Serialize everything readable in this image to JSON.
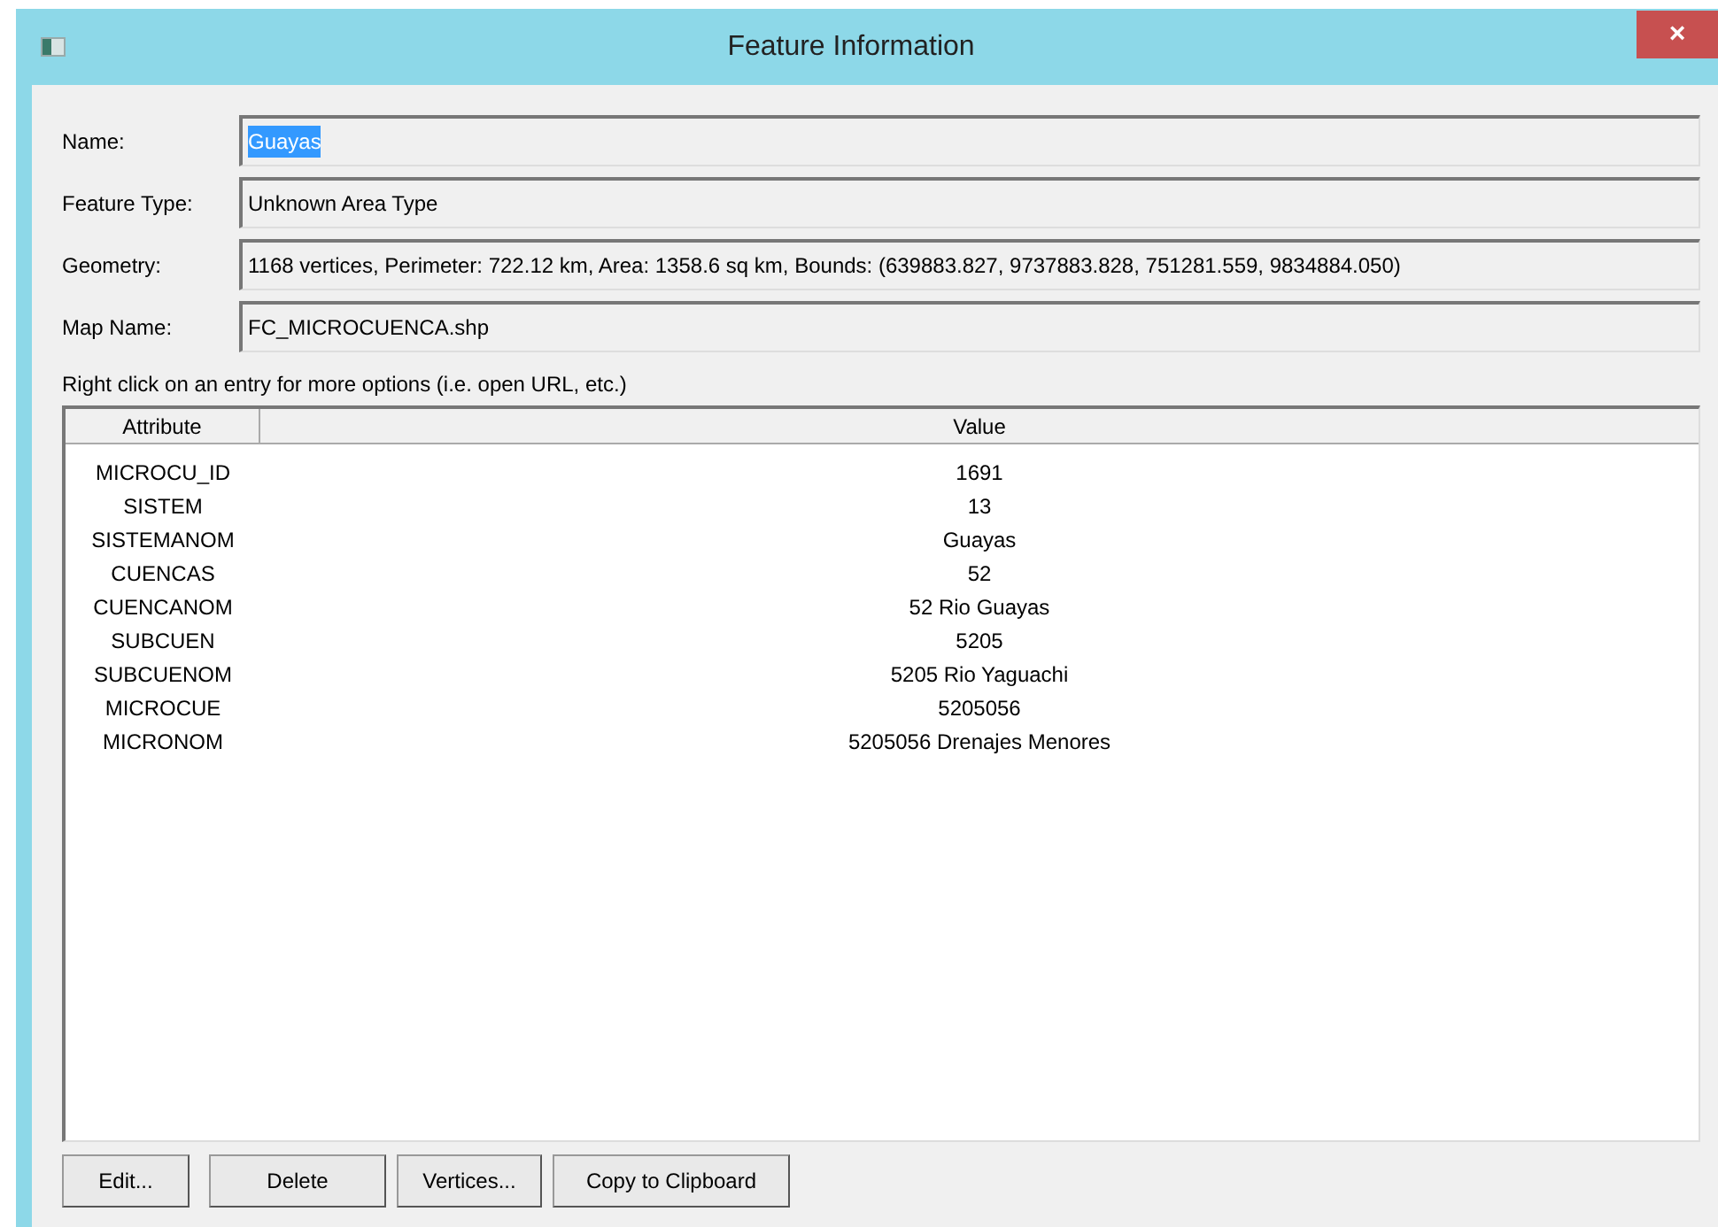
{
  "window": {
    "title": "Feature Information",
    "close": "×"
  },
  "fields": [
    {
      "label": "Name:",
      "value": "Guayas",
      "selected": true
    },
    {
      "label": "Feature Type:",
      "value": "Unknown Area Type",
      "selected": false
    },
    {
      "label": "Geometry:",
      "value": "1168 vertices, Perimeter: 722.12 km, Area: 1358.6 sq km, Bounds: (639883.827, 9737883.828, 751281.559, 9834884.050)",
      "selected": false
    },
    {
      "label": "Map Name:",
      "value": "FC_MICROCUENCA.shp",
      "selected": false
    }
  ],
  "hint": "Right click on an entry for more options (i.e. open URL, etc.)",
  "table": {
    "columns": [
      "Attribute",
      "Value"
    ],
    "rows": [
      [
        "MICROCU_ID",
        "1691"
      ],
      [
        "SISTEM",
        "13"
      ],
      [
        "SISTEMANOM",
        "Guayas"
      ],
      [
        "CUENCAS",
        "52"
      ],
      [
        "CUENCANOM",
        "52 Rio Guayas"
      ],
      [
        "SUBCUEN",
        "5205"
      ],
      [
        "SUBCUENOM",
        "5205 Rio Yaguachi"
      ],
      [
        "MICROCUE",
        "5205056"
      ],
      [
        "MICRONOM",
        "5205056 Drenajes Menores"
      ]
    ]
  },
  "buttons": [
    "Edit...",
    "Delete",
    "Vertices...",
    "Copy to Clipboard"
  ]
}
